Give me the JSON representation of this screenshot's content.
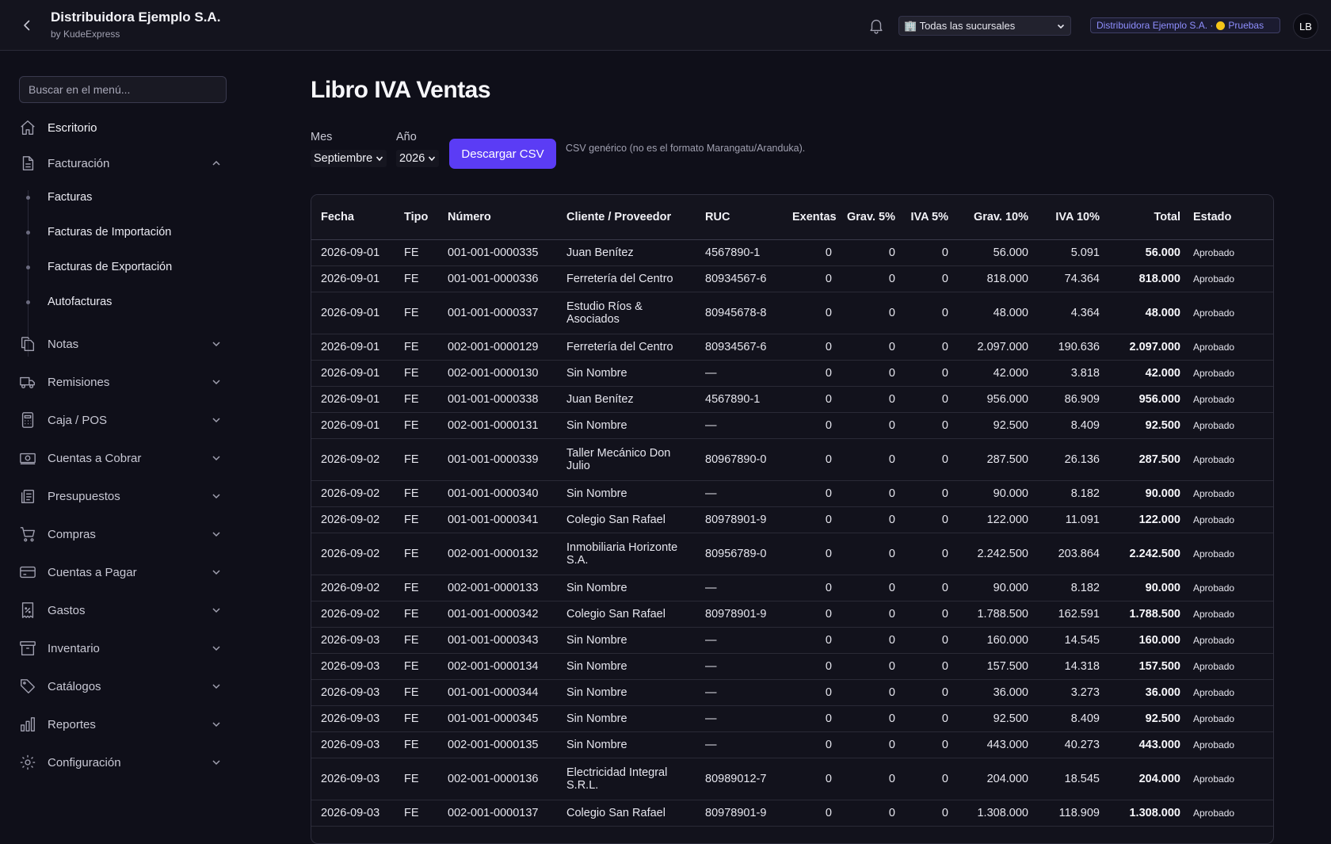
{
  "header": {
    "company": "Distribuidora Ejemplo S.A.",
    "byline": "by KudeExpress",
    "branch_select": "🏢 Todas las sucursales",
    "company_badge": "Distribuidora Ejemplo S.A. ·",
    "env_label": "Pruebas",
    "avatar_initials": "LB"
  },
  "sidebar": {
    "search_placeholder": "Buscar en el menú...",
    "items": [
      {
        "label": "Escritorio",
        "icon": "home-icon"
      },
      {
        "label": "Facturación",
        "icon": "document-icon",
        "expanded": true
      },
      {
        "label": "Notas",
        "icon": "notes-icon"
      },
      {
        "label": "Remisiones",
        "icon": "truck-icon"
      },
      {
        "label": "Caja / POS",
        "icon": "calculator-icon"
      },
      {
        "label": "Cuentas a Cobrar",
        "icon": "cash-icon"
      },
      {
        "label": "Presupuestos",
        "icon": "clipboard-icon"
      },
      {
        "label": "Compras",
        "icon": "cart-icon"
      },
      {
        "label": "Cuentas a Pagar",
        "icon": "credit-card-icon"
      },
      {
        "label": "Gastos",
        "icon": "receipt-percent-icon"
      },
      {
        "label": "Inventario",
        "icon": "archive-box-icon"
      },
      {
        "label": "Catálogos",
        "icon": "tag-icon"
      },
      {
        "label": "Reportes",
        "icon": "bar-chart-icon"
      },
      {
        "label": "Configuración",
        "icon": "gear-icon"
      }
    ],
    "facturacion_sub": [
      "Facturas",
      "Facturas de Importación",
      "Facturas de Exportación",
      "Autofacturas"
    ]
  },
  "main": {
    "title": "Libro IVA Ventas",
    "mes_label": "Mes",
    "mes_value": "Septiembre",
    "anio_label": "Año",
    "anio_value": "2026",
    "download_button": "Descargar CSV",
    "csv_note": "CSV genérico (no es el formato Marangatu/Aranduka)."
  },
  "table": {
    "columns": [
      "Fecha",
      "Tipo",
      "Número",
      "Cliente / Proveedor",
      "RUC",
      "Exentas",
      "Grav. 5%",
      "IVA 5%",
      "Grav. 10%",
      "IVA 10%",
      "Total",
      "Estado"
    ],
    "rows": [
      [
        "2026-09-01",
        "FE",
        "001-001-0000335",
        "Juan Benítez",
        "4567890-1",
        "0",
        "0",
        "0",
        "56.000",
        "5.091",
        "56.000",
        "Aprobado"
      ],
      [
        "2026-09-01",
        "FE",
        "001-001-0000336",
        "Ferretería del Centro",
        "80934567-6",
        "0",
        "0",
        "0",
        "818.000",
        "74.364",
        "818.000",
        "Aprobado"
      ],
      [
        "2026-09-01",
        "FE",
        "001-001-0000337",
        "Estudio Ríos & Asociados",
        "80945678-8",
        "0",
        "0",
        "0",
        "48.000",
        "4.364",
        "48.000",
        "Aprobado"
      ],
      [
        "2026-09-01",
        "FE",
        "002-001-0000129",
        "Ferretería del Centro",
        "80934567-6",
        "0",
        "0",
        "0",
        "2.097.000",
        "190.636",
        "2.097.000",
        "Aprobado"
      ],
      [
        "2026-09-01",
        "FE",
        "002-001-0000130",
        "Sin Nombre",
        "—",
        "0",
        "0",
        "0",
        "42.000",
        "3.818",
        "42.000",
        "Aprobado"
      ],
      [
        "2026-09-01",
        "FE",
        "001-001-0000338",
        "Juan Benítez",
        "4567890-1",
        "0",
        "0",
        "0",
        "956.000",
        "86.909",
        "956.000",
        "Aprobado"
      ],
      [
        "2026-09-01",
        "FE",
        "002-001-0000131",
        "Sin Nombre",
        "—",
        "0",
        "0",
        "0",
        "92.500",
        "8.409",
        "92.500",
        "Aprobado"
      ],
      [
        "2026-09-02",
        "FE",
        "001-001-0000339",
        "Taller Mecánico Don Julio",
        "80967890-0",
        "0",
        "0",
        "0",
        "287.500",
        "26.136",
        "287.500",
        "Aprobado"
      ],
      [
        "2026-09-02",
        "FE",
        "001-001-0000340",
        "Sin Nombre",
        "—",
        "0",
        "0",
        "0",
        "90.000",
        "8.182",
        "90.000",
        "Aprobado"
      ],
      [
        "2026-09-02",
        "FE",
        "001-001-0000341",
        "Colegio San Rafael",
        "80978901-9",
        "0",
        "0",
        "0",
        "122.000",
        "11.091",
        "122.000",
        "Aprobado"
      ],
      [
        "2026-09-02",
        "FE",
        "002-001-0000132",
        "Inmobiliaria Horizonte S.A.",
        "80956789-0",
        "0",
        "0",
        "0",
        "2.242.500",
        "203.864",
        "2.242.500",
        "Aprobado"
      ],
      [
        "2026-09-02",
        "FE",
        "002-001-0000133",
        "Sin Nombre",
        "—",
        "0",
        "0",
        "0",
        "90.000",
        "8.182",
        "90.000",
        "Aprobado"
      ],
      [
        "2026-09-02",
        "FE",
        "001-001-0000342",
        "Colegio San Rafael",
        "80978901-9",
        "0",
        "0",
        "0",
        "1.788.500",
        "162.591",
        "1.788.500",
        "Aprobado"
      ],
      [
        "2026-09-03",
        "FE",
        "001-001-0000343",
        "Sin Nombre",
        "—",
        "0",
        "0",
        "0",
        "160.000",
        "14.545",
        "160.000",
        "Aprobado"
      ],
      [
        "2026-09-03",
        "FE",
        "002-001-0000134",
        "Sin Nombre",
        "—",
        "0",
        "0",
        "0",
        "157.500",
        "14.318",
        "157.500",
        "Aprobado"
      ],
      [
        "2026-09-03",
        "FE",
        "001-001-0000344",
        "Sin Nombre",
        "—",
        "0",
        "0",
        "0",
        "36.000",
        "3.273",
        "36.000",
        "Aprobado"
      ],
      [
        "2026-09-03",
        "FE",
        "001-001-0000345",
        "Sin Nombre",
        "—",
        "0",
        "0",
        "0",
        "92.500",
        "8.409",
        "92.500",
        "Aprobado"
      ],
      [
        "2026-09-03",
        "FE",
        "002-001-0000135",
        "Sin Nombre",
        "—",
        "0",
        "0",
        "0",
        "443.000",
        "40.273",
        "443.000",
        "Aprobado"
      ],
      [
        "2026-09-03",
        "FE",
        "002-001-0000136",
        "Electricidad Integral S.R.L.",
        "80989012-7",
        "0",
        "0",
        "0",
        "204.000",
        "18.545",
        "204.000",
        "Aprobado"
      ],
      [
        "2026-09-03",
        "FE",
        "002-001-0000137",
        "Colegio San Rafael",
        "80978901-9",
        "0",
        "0",
        "0",
        "1.308.000",
        "118.909",
        "1.308.000",
        "Aprobado"
      ]
    ]
  },
  "colors": {
    "background": "#0f0f19",
    "topbar": "#14141e",
    "accent": "#5b3cf5",
    "badge_text": "#8f8fff",
    "env_dot": "#f5c518"
  }
}
